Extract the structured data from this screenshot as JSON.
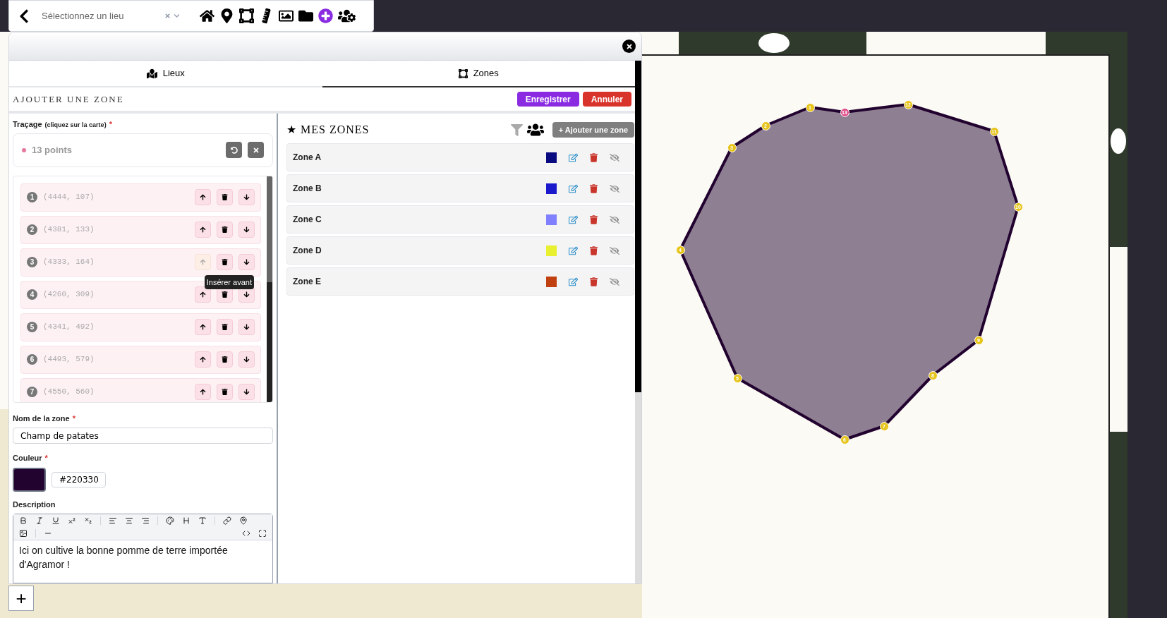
{
  "top_bar": {
    "place_select": {
      "placeholder": "Sélectionnez un lieu"
    },
    "tools": [
      {
        "kind": "home"
      },
      {
        "kind": "pin"
      },
      {
        "kind": "zone"
      },
      {
        "kind": "ruler"
      },
      {
        "kind": "image"
      },
      {
        "kind": "folder"
      },
      {
        "kind": "add"
      },
      {
        "kind": "users"
      }
    ]
  },
  "panel": {
    "tabs": [
      {
        "label": "Lieux",
        "kind": "places",
        "selected": false
      },
      {
        "label": "Zones",
        "kind": "zones",
        "selected": true
      }
    ],
    "form_title": "AJOUTER UNE ZONE",
    "actions": [
      {
        "label": "Enregistrer",
        "kind": "primary"
      },
      {
        "label": "Annuler",
        "kind": "danger"
      }
    ],
    "tracing": {
      "label": "Traçage",
      "hint": "(cliquez sur la carte)",
      "required": "*",
      "count": "13 points"
    },
    "points": {
      "tooltip": "Insérer avant",
      "items": [
        {
          "number": "1",
          "coords": "(4444, 107)",
          "hovered": false
        },
        {
          "number": "2",
          "coords": "(4381, 133)",
          "hovered": false
        },
        {
          "number": "3",
          "coords": "(4333, 164)",
          "hovered": true
        },
        {
          "number": "4",
          "coords": "(4260, 309)",
          "hovered": false
        },
        {
          "number": "5",
          "coords": "(4341, 492)",
          "hovered": false
        },
        {
          "number": "6",
          "coords": "(4493, 579)",
          "hovered": false
        },
        {
          "number": "7",
          "coords": "(4550, 560)",
          "hovered": false
        }
      ]
    },
    "name_field": {
      "label": "Nom de la zone",
      "required": "*",
      "value": "Champ de patates"
    },
    "color_field": {
      "label": "Couleur",
      "required": "*",
      "value": "#220330"
    },
    "description": {
      "label": "Description",
      "value": "Ici on cultive la bonne pomme de terre importée d'Agramor !"
    },
    "zones": {
      "title": "★ MES ZONES",
      "add_button": "+ Ajouter une zone",
      "items": [
        {
          "name": "Zone A",
          "color": "#0a0a80"
        },
        {
          "name": "Zone B",
          "color": "#1a1acc"
        },
        {
          "name": "Zone C",
          "color": "#8080ff"
        },
        {
          "name": "Zone D",
          "color": "#e8f030"
        },
        {
          "name": "Zone E",
          "color": "#c04010"
        }
      ]
    }
  },
  "map": {
    "zoom_in": "+",
    "markers": [
      {
        "label": "1",
        "selected": false
      },
      {
        "label": "2",
        "selected": false
      },
      {
        "label": "3",
        "selected": false
      },
      {
        "label": "4",
        "selected": false
      },
      {
        "label": "5",
        "selected": false
      },
      {
        "label": "6",
        "selected": false
      },
      {
        "label": "7",
        "selected": false
      },
      {
        "label": "8",
        "selected": false
      },
      {
        "label": "9",
        "selected": false
      },
      {
        "label": "10",
        "selected": false
      },
      {
        "label": "11",
        "selected": false
      },
      {
        "label": "12",
        "selected": false
      },
      {
        "label": "13",
        "selected": true
      }
    ]
  }
}
